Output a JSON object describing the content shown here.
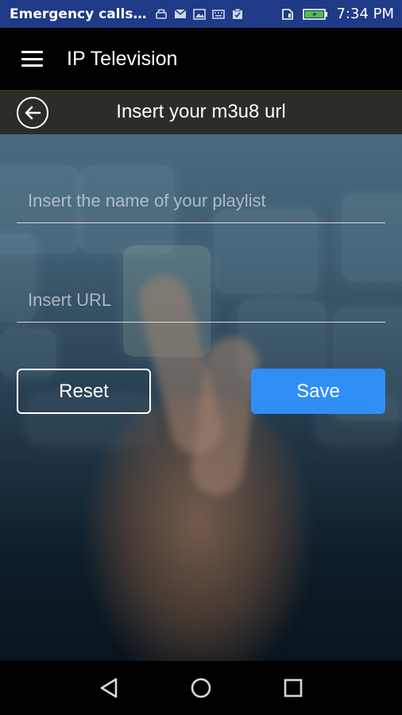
{
  "status_bar": {
    "notification_text": "Emergency calls…",
    "time": "7:34 PM",
    "icons_left": [
      "android-icon",
      "mail-icon",
      "image-icon",
      "keyboard-icon",
      "clipboard-icon"
    ],
    "icons_right": [
      "sim-icon",
      "battery-charging-icon"
    ]
  },
  "app_bar": {
    "title": "IP Television",
    "menu_icon": "hamburger-menu-icon"
  },
  "sub_header": {
    "title": "Insert your m3u8 url",
    "back_icon": "back-arrow-icon"
  },
  "form": {
    "playlist_name": {
      "value": "",
      "placeholder": "Insert the name of your playlist"
    },
    "url": {
      "value": "",
      "placeholder": "Insert URL"
    },
    "reset_label": "Reset",
    "save_label": "Save"
  },
  "colors": {
    "status_bar": "#1f3a86",
    "sub_header": "#2d2c27",
    "save_button": "#2f8ff6"
  },
  "nav_bar": {
    "icons": [
      "back-triangle-icon",
      "home-circle-icon",
      "recents-square-icon"
    ]
  }
}
